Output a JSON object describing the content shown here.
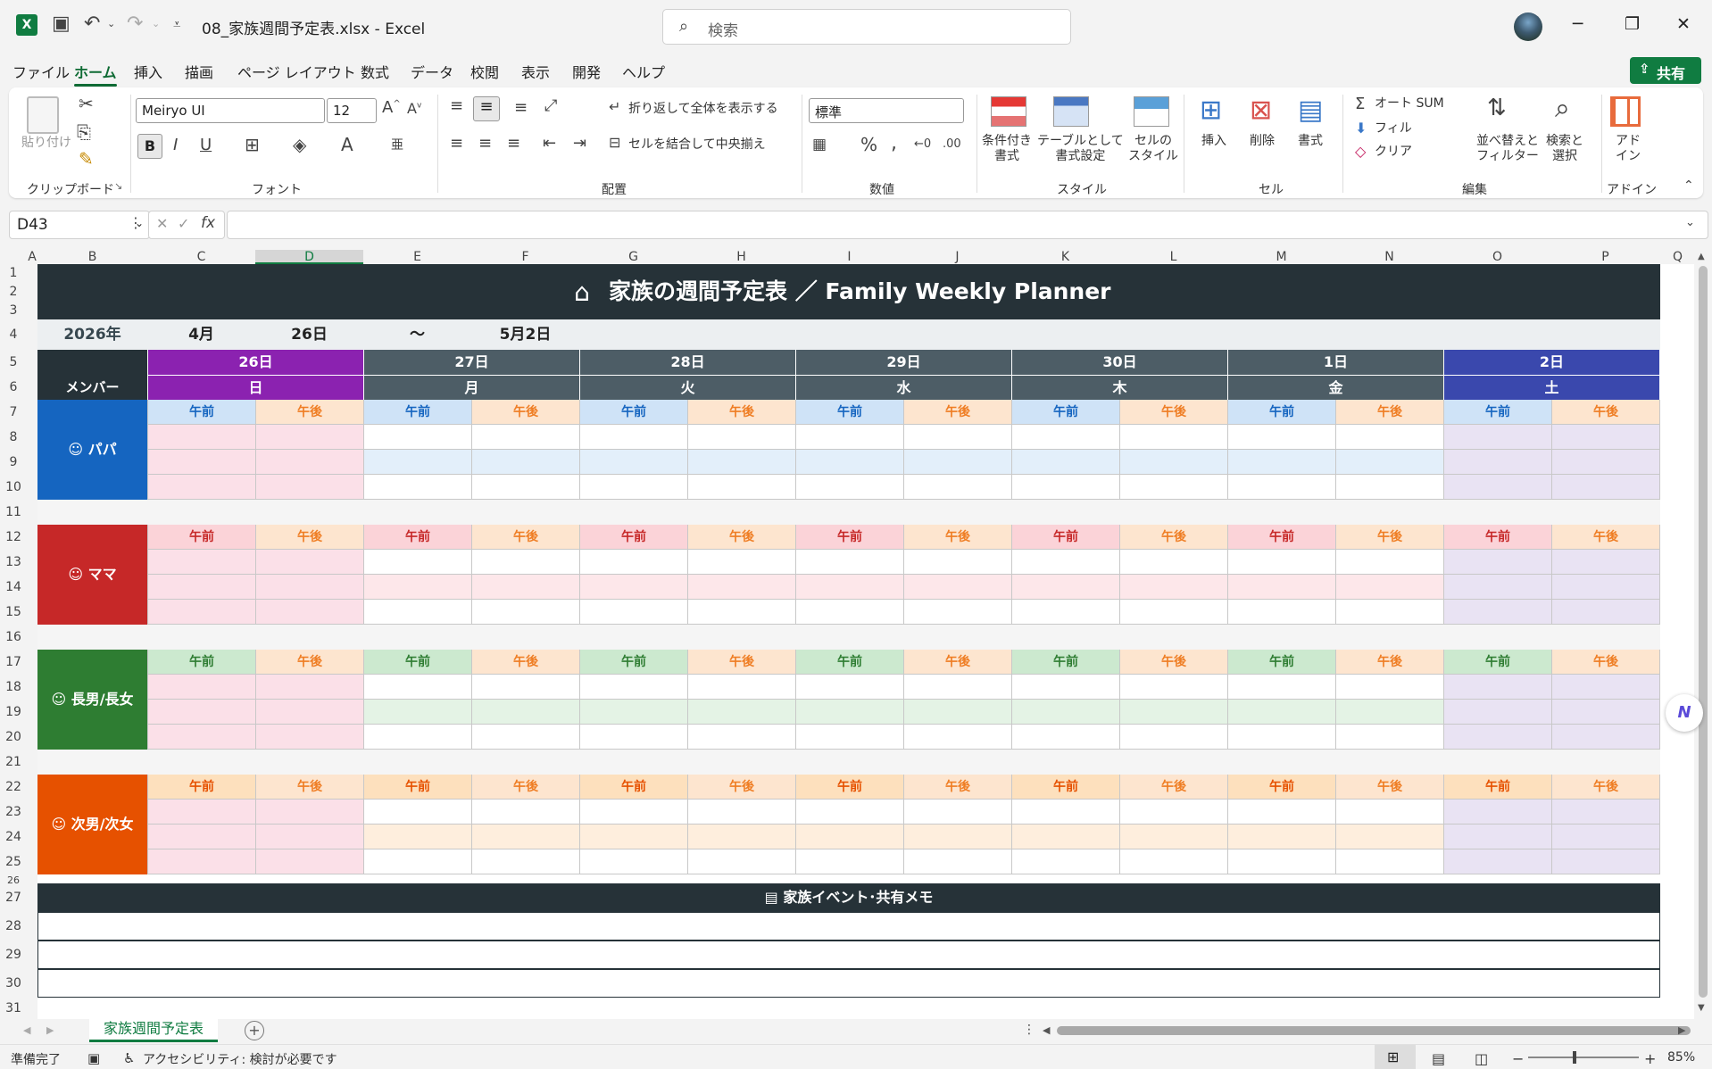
{
  "app": {
    "filename": "08_家族週間予定表.xlsx",
    "app_name": "Excel",
    "separator": "-"
  },
  "search": {
    "placeholder": "検索"
  },
  "tabs": [
    {
      "label": "ファイル"
    },
    {
      "label": "ホーム"
    },
    {
      "label": "挿入"
    },
    {
      "label": "描画"
    },
    {
      "label": "ページ レイアウト"
    },
    {
      "label": "数式"
    },
    {
      "label": "データ"
    },
    {
      "label": "校閲"
    },
    {
      "label": "表示"
    },
    {
      "label": "開発"
    },
    {
      "label": "ヘルプ"
    }
  ],
  "share_label": "共有",
  "ribbon": {
    "clipboard": {
      "paste": "貼り付け",
      "group": "クリップボード"
    },
    "font": {
      "name": "Meiryo UI",
      "size": "12",
      "group": "フォント"
    },
    "align": {
      "wrap": "折り返して全体を表示する",
      "merge": "セルを結合して中央揃え",
      "group": "配置"
    },
    "number": {
      "format": "標準",
      "group": "数値"
    },
    "style": {
      "cond1": "条件付き",
      "cond2": "書式",
      "table1": "テーブルとして",
      "table2": "書式設定",
      "cell1": "セルの",
      "cell2": "スタイル",
      "group": "スタイル"
    },
    "cells": {
      "insert": "挿入",
      "delete": "削除",
      "format": "書式",
      "group": "セル"
    },
    "edit": {
      "autosum": "オート SUM",
      "fill": "フィル",
      "clear": "クリア",
      "sort1": "並べ替えと",
      "sort2": "フィルター",
      "find1": "検索と",
      "find2": "選択",
      "group": "編集"
    },
    "addin": {
      "l1": "アド",
      "l2": "イン",
      "group": "アドイン"
    }
  },
  "namebox": "D43",
  "columns": [
    "A",
    "B",
    "C",
    "D",
    "E",
    "F",
    "G",
    "H",
    "I",
    "J",
    "K",
    "L",
    "M",
    "N",
    "O",
    "P",
    "Q"
  ],
  "rows": [
    "1",
    "2",
    "3",
    "4",
    "5",
    "6",
    "7",
    "8",
    "9",
    "10",
    "11",
    "12",
    "13",
    "14",
    "15",
    "16",
    "17",
    "18",
    "19",
    "20",
    "21",
    "22",
    "23",
    "24",
    "25",
    "26",
    "27",
    "28",
    "29",
    "30",
    "31"
  ],
  "planner": {
    "title": "家族の週間予定表 ／ Family Weekly Planner",
    "year": "2026年",
    "start_month": "4月",
    "start_day": "26日",
    "tilde": "～",
    "end": "5月2日",
    "member_header": "メンバー",
    "days": [
      {
        "date": "26日",
        "weekday": "日",
        "color": "#8b22b0"
      },
      {
        "date": "27日",
        "weekday": "月",
        "color": "#4d5d66"
      },
      {
        "date": "28日",
        "weekday": "火",
        "color": "#4d5d66"
      },
      {
        "date": "29日",
        "weekday": "水",
        "color": "#4d5d66"
      },
      {
        "date": "30日",
        "weekday": "木",
        "color": "#4d5d66"
      },
      {
        "date": "1日",
        "weekday": "金",
        "color": "#4d5d66"
      },
      {
        "date": "2日",
        "weekday": "土",
        "color": "#3a48ad"
      }
    ],
    "am": "午前",
    "pm": "午後",
    "members": [
      {
        "name": "パパ",
        "color": "#1565c0",
        "am_bg": "#cfe3f7",
        "am_fg": "#1565c0",
        "stripe": "#e3effa"
      },
      {
        "name": "ママ",
        "color": "#c62828",
        "am_bg": "#fbd3d8",
        "am_fg": "#c62828",
        "stripe": "#fde7ea"
      },
      {
        "name": "長男/長女",
        "color": "#2e7d32",
        "am_bg": "#cce9cf",
        "am_fg": "#2e7d32",
        "stripe": "#e4f3e5"
      },
      {
        "name": "次男/次女",
        "color": "#e65100",
        "am_bg": "#fde0bd",
        "am_fg": "#e65100",
        "stripe": "#feeedd"
      }
    ],
    "memo_title": "家族イベント･共有メモ"
  },
  "sheet_tab": "家族週間予定表",
  "status": {
    "ready": "準備完了",
    "accessibility": "アクセシビリティ: 検討が必要です",
    "zoom": "85%"
  }
}
